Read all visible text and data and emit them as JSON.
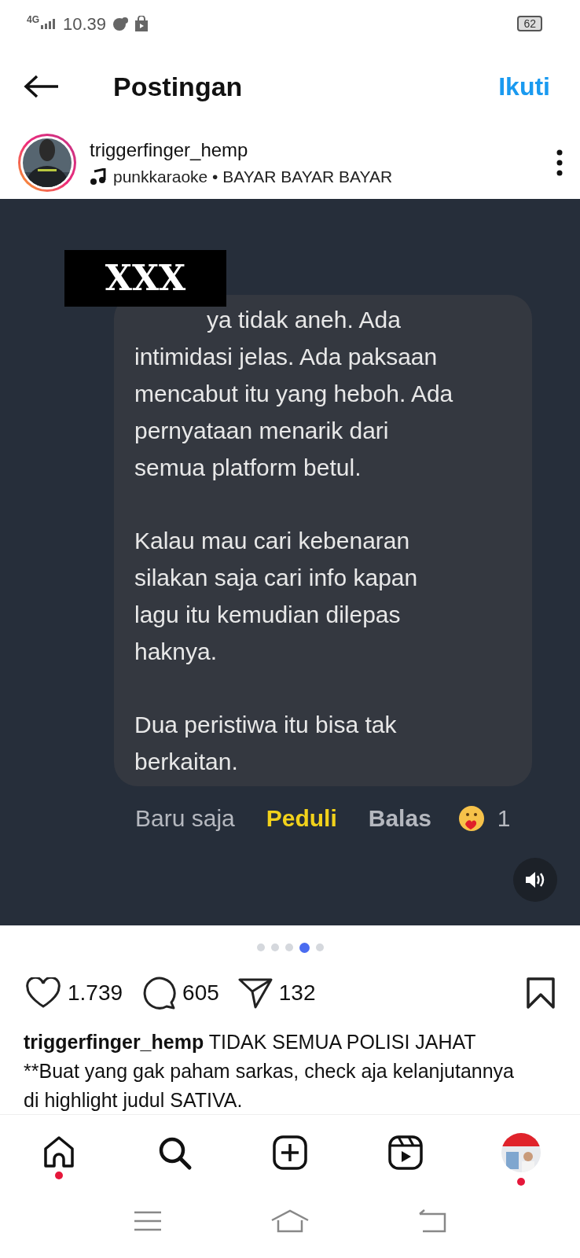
{
  "status_bar": {
    "network": "4G",
    "time": "10.39",
    "battery": "62"
  },
  "header": {
    "title": "Postingan",
    "follow": "Ikuti"
  },
  "author": {
    "username": "triggerfinger_hemp",
    "audio": "punkkaraoke • BAYAR BAYAR BAYAR"
  },
  "post": {
    "censor_label": "XXX",
    "comment_paragraphs": [
      [
        "ya tidak aneh. Ada",
        "intimidasi jelas. Ada paksaan",
        "mencabut itu yang heboh. Ada",
        "pernyataan menarik dari",
        "semua platform betul."
      ],
      [
        "Kalau mau cari kebenaran",
        "silakan saja cari info kapan",
        "lagu itu kemudian dilepas",
        "haknya."
      ],
      [
        "Dua peristiwa itu bisa tak",
        "berkaitan."
      ]
    ],
    "comment_meta": {
      "time": "Baru saja",
      "reaction": "Peduli",
      "reply": "Balas",
      "reaction_count": "1"
    }
  },
  "carousel": [
    {
      "selected": false
    },
    {
      "selected": false
    },
    {
      "selected": false
    },
    {
      "selected": true
    },
    {
      "selected": false
    }
  ],
  "actions": {
    "likes": "1.739",
    "comments": "605",
    "shares": "132"
  },
  "caption": {
    "username": "triggerfinger_hemp",
    "text": "TIDAK SEMUA POLISI JAHAT **Buat yang gak paham sarkas, check aja kelanjutannya di highlight judul SATIVA."
  },
  "nav": [
    {
      "kind": "home",
      "badge": true
    },
    {
      "kind": "search",
      "badge": false
    },
    {
      "kind": "create",
      "badge": false
    },
    {
      "kind": "reels",
      "badge": false
    },
    {
      "kind": "profile",
      "badge": true
    }
  ]
}
